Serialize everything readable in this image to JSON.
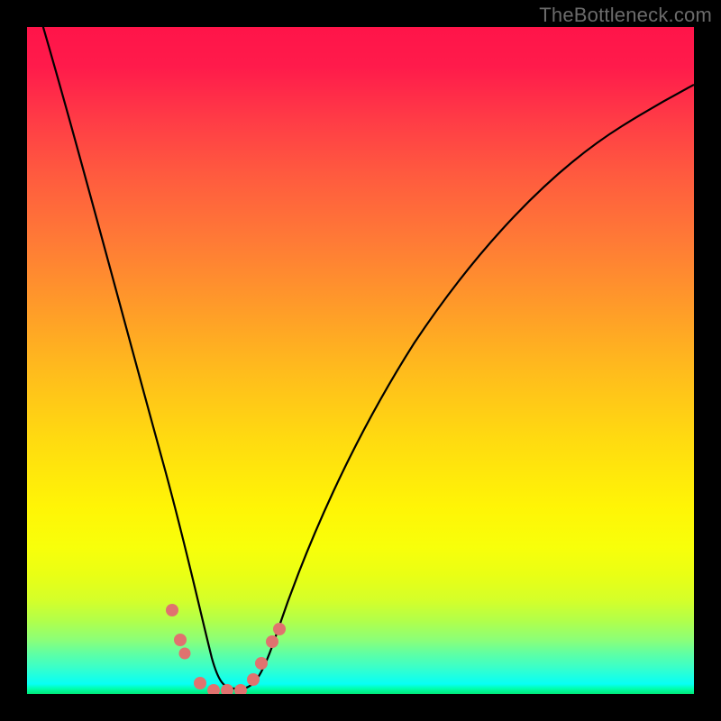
{
  "watermark": "TheBottleneck.com",
  "chart_data": {
    "type": "line",
    "title": "",
    "xlabel": "",
    "ylabel": "",
    "xlim": [
      0,
      1
    ],
    "ylim": [
      0,
      1
    ],
    "series": [
      {
        "name": "bottleneck-curve",
        "x": [
          0.0,
          0.03,
          0.06,
          0.09,
          0.12,
          0.15,
          0.18,
          0.21,
          0.23,
          0.25,
          0.27,
          0.29,
          0.31,
          0.33,
          0.36,
          0.4,
          0.45,
          0.5,
          0.55,
          0.6,
          0.65,
          0.7,
          0.75,
          0.8,
          0.85,
          0.9,
          0.95,
          1.0
        ],
        "y": [
          1.08,
          0.95,
          0.82,
          0.7,
          0.58,
          0.47,
          0.35,
          0.24,
          0.16,
          0.09,
          0.04,
          0.0,
          0.0,
          0.01,
          0.05,
          0.13,
          0.23,
          0.33,
          0.42,
          0.5,
          0.57,
          0.63,
          0.69,
          0.74,
          0.78,
          0.82,
          0.855,
          0.885
        ]
      },
      {
        "name": "curve-dots",
        "points": [
          {
            "x": 0.217,
            "y": 0.125
          },
          {
            "x": 0.23,
            "y": 0.081
          },
          {
            "x": 0.237,
            "y": 0.06
          },
          {
            "x": 0.26,
            "y": 0.016
          },
          {
            "x": 0.28,
            "y": 0.003
          },
          {
            "x": 0.3,
            "y": 0.003
          },
          {
            "x": 0.32,
            "y": 0.003
          },
          {
            "x": 0.339,
            "y": 0.022
          },
          {
            "x": 0.352,
            "y": 0.046
          },
          {
            "x": 0.368,
            "y": 0.078
          },
          {
            "x": 0.378,
            "y": 0.097
          }
        ]
      }
    ],
    "gradient_stops": [
      {
        "pos": 0.0,
        "color": "#ff1449"
      },
      {
        "pos": 0.5,
        "color": "#ffd514"
      },
      {
        "pos": 0.8,
        "color": "#f8ff0a"
      },
      {
        "pos": 1.0,
        "color": "#00e878"
      }
    ]
  }
}
